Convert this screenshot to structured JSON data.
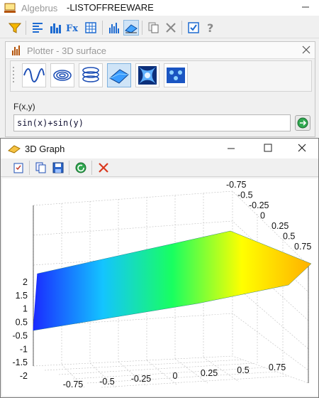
{
  "window": {
    "app_name": "Algebrus",
    "document_title": "-LISTOFFREEWARE"
  },
  "toolbar_icons": [
    "funnel-icon",
    "align-left-icon",
    "bar-chart-icon",
    "fx-icon",
    "table-icon",
    "histogram-icon",
    "surface-icon",
    "copy-icon",
    "close-icon",
    "check-icon",
    "help-icon"
  ],
  "plotter": {
    "title": "Plotter - 3D surface",
    "surface_types": [
      "sine-wave-icon",
      "spiral-icon",
      "coil-icon",
      "surface-icon",
      "pillow-icon",
      "dots-icon"
    ],
    "selected_surface_type": "surface-icon",
    "function_label": "F(x,y)",
    "function_value": "sin(x)+sin(y)"
  },
  "graph_window": {
    "title": "3D Graph",
    "tools": [
      "save-report-icon",
      "copy-icon",
      "save-icon",
      "refresh-icon",
      "delete-icon"
    ]
  },
  "chart_data": {
    "type": "surface",
    "function": "sin(x)+sin(y)",
    "x_ticks": [
      "-0.75",
      "-0.5",
      "-0.25",
      "0",
      "0.25",
      "0.5",
      "0.75"
    ],
    "y_ticks": [
      "-0.75",
      "-0.5",
      "-0.25",
      "0",
      "0.25",
      "0.5",
      "0.75"
    ],
    "z_ticks": [
      "-2",
      "-1.5",
      "-1",
      "-0.5",
      "0.5",
      "1",
      "1.5",
      "2"
    ],
    "xlim": [
      -1,
      1
    ],
    "ylim": [
      -1,
      1
    ],
    "zlim": [
      -2,
      2
    ],
    "grid": true,
    "colormap": [
      "#1a2bff",
      "#14c4ff",
      "#18ff60",
      "#ffff00",
      "#ffb000"
    ]
  }
}
